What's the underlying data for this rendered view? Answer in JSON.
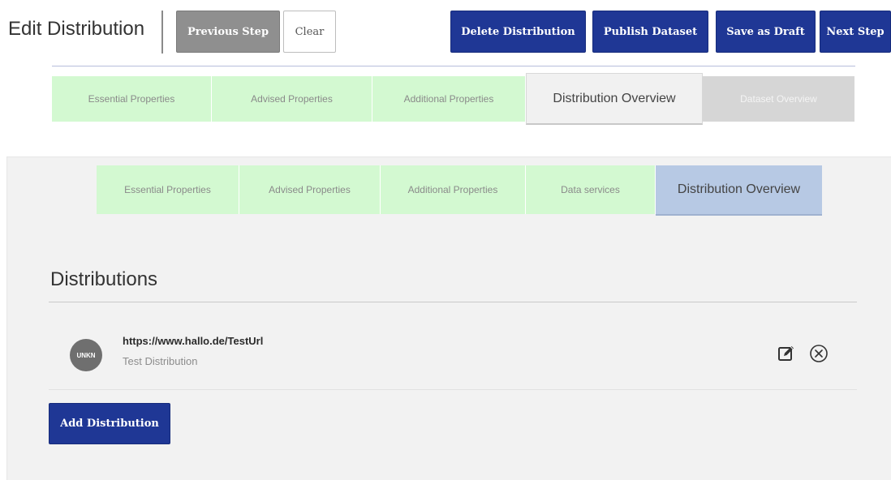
{
  "header": {
    "title": "Edit Distribution",
    "previous_step_label": "Previous Step",
    "clear_label": "Clear",
    "delete_distribution_label": "Delete Distribution",
    "publish_dataset_label": "Publish Dataset",
    "save_as_draft_label": "Save as Draft",
    "next_step_label": "Next Step"
  },
  "step_tabs": [
    {
      "label": "Essential Properties",
      "state": "completed"
    },
    {
      "label": "Advised Properties",
      "state": "completed"
    },
    {
      "label": "Additional Properties",
      "state": "completed"
    },
    {
      "label": "Distribution Overview",
      "state": "active"
    },
    {
      "label": "Dataset Overview",
      "state": "disabled"
    }
  ],
  "distribution_tabs": [
    {
      "label": "Essential Properties",
      "state": "completed"
    },
    {
      "label": "Advised Properties",
      "state": "completed"
    },
    {
      "label": "Additional Properties",
      "state": "completed"
    },
    {
      "label": "Data services",
      "state": "completed"
    },
    {
      "label": "Distribution Overview",
      "state": "active"
    }
  ],
  "distributions": {
    "heading": "Distributions",
    "items": [
      {
        "format_badge": "UNKN",
        "url": "https://www.hallo.de/TestUrl",
        "description": "Test Distribution",
        "edit_icon": "edit-icon",
        "remove_icon": "circle-x-icon"
      }
    ],
    "add_label": "Add Distribution"
  },
  "colors": {
    "navy_button": "#1f3795",
    "grey_button": "#8f8f8f",
    "completed_tab": "#d3f9d1",
    "active_tab_blue": "#b7c9e4",
    "disabled_tab": "#d6d6d6",
    "panel_background": "#f2f2f2"
  }
}
